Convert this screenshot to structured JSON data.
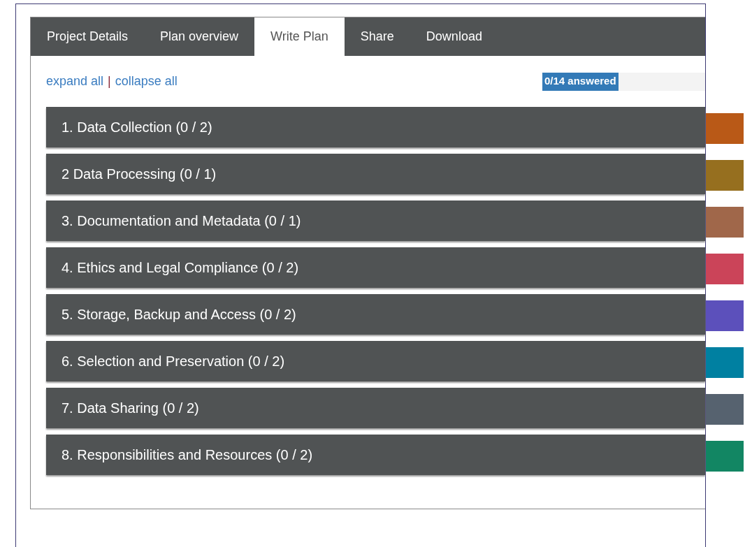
{
  "tabs": [
    {
      "label": "Project Details",
      "selected": false
    },
    {
      "label": "Plan overview",
      "selected": false
    },
    {
      "label": "Write Plan",
      "selected": true
    },
    {
      "label": "Share",
      "selected": false
    },
    {
      "label": "Download",
      "selected": false
    }
  ],
  "links": {
    "expand": "expand all",
    "separator": "|",
    "collapse": "collapse all"
  },
  "progress": {
    "label": "0/14 answered"
  },
  "sections": [
    {
      "title": "1. Data Collection (0 / 2)",
      "color": "#b95917"
    },
    {
      "title": "2 Data Processing (0 / 1)",
      "color": "#966f1f"
    },
    {
      "title": "3. Documentation and Metadata (0 / 1)",
      "color": "#a0674a"
    },
    {
      "title": "4. Ethics and Legal Compliance (0 / 2)",
      "color": "#cb4459"
    },
    {
      "title": "5. Storage, Backup and Access (0 / 2)",
      "color": "#5c50bb"
    },
    {
      "title": "6. Selection and Preservation (0 / 2)",
      "color": "#0080a1"
    },
    {
      "title": "7. Data Sharing (0 / 2)",
      "color": "#56626f"
    },
    {
      "title": "8. Responsibilities and Resources (0 / 2)",
      "color": "#128663"
    }
  ]
}
